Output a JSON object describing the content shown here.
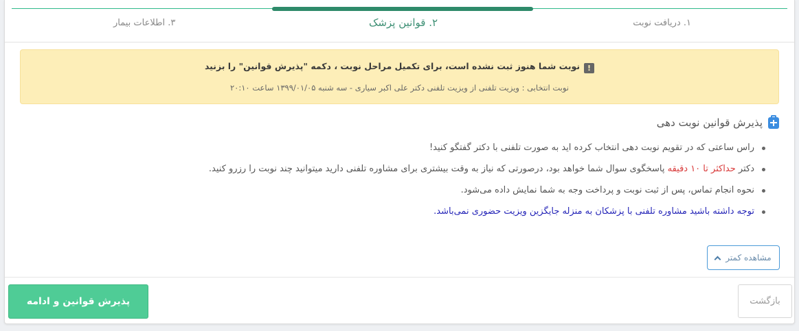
{
  "steps": [
    {
      "label": "۱. دریافت نوبت"
    },
    {
      "label": "۲. قوانین پزشک"
    },
    {
      "label": "۳. اطلاعات بیمار"
    }
  ],
  "alert": {
    "icon": "exclamation-icon",
    "icon_glyph": "!",
    "message": "نوبت شما هنوز ثبت نشده است، برای تکمیل مراحل نوبت ، دکمه \"پذیرش قوانین\" را بزنید",
    "detail": "نوبت انتخابی : ویزیت تلفنی از ویزیت تلفنی دکتر علی اکبر سیاری - سه شنبه ۱۳۹۹/۰۱/۰۵ ساعت ۲۰:۱۰"
  },
  "rules_section": {
    "title": "پذیرش قوانین نوبت دهی",
    "items": {
      "item1": "راس ساعتی که در تقویم نوبت دهی انتخاب کرده اید به صورت تلفنی با دکتر گفتگو کنید!",
      "item2_prefix": "دکتر ",
      "item2_highlight": "حداکثر تا ۱۰ دقیقه",
      "item2_suffix": " پاسخگوی سوال شما خواهد بود، درصورتی که نیاز به وقت بیشتری برای مشاوره تلفنی دارید میتوانید چند نوبت را رزرو کنید.",
      "item3": "نحوه انجام تماس، پس از ثبت نوبت و پرداخت وجه به شما نمایش داده می‌شود.",
      "item4": "توجه داشته باشید مشاوره تلفنی با پزشکان به منزله جایگزین ویزیت حضوری نمی‌باشد."
    },
    "show_less_label": "مشاهده کمتر"
  },
  "footer": {
    "accept_label": "پذیرش قوانین و ادامه",
    "back_label": "بازگشت"
  },
  "colors": {
    "accent_green": "#4fcc96",
    "warning_bg": "#fdeeb8",
    "highlight_red": "#d93a3a",
    "note_blue": "#2626b8"
  }
}
